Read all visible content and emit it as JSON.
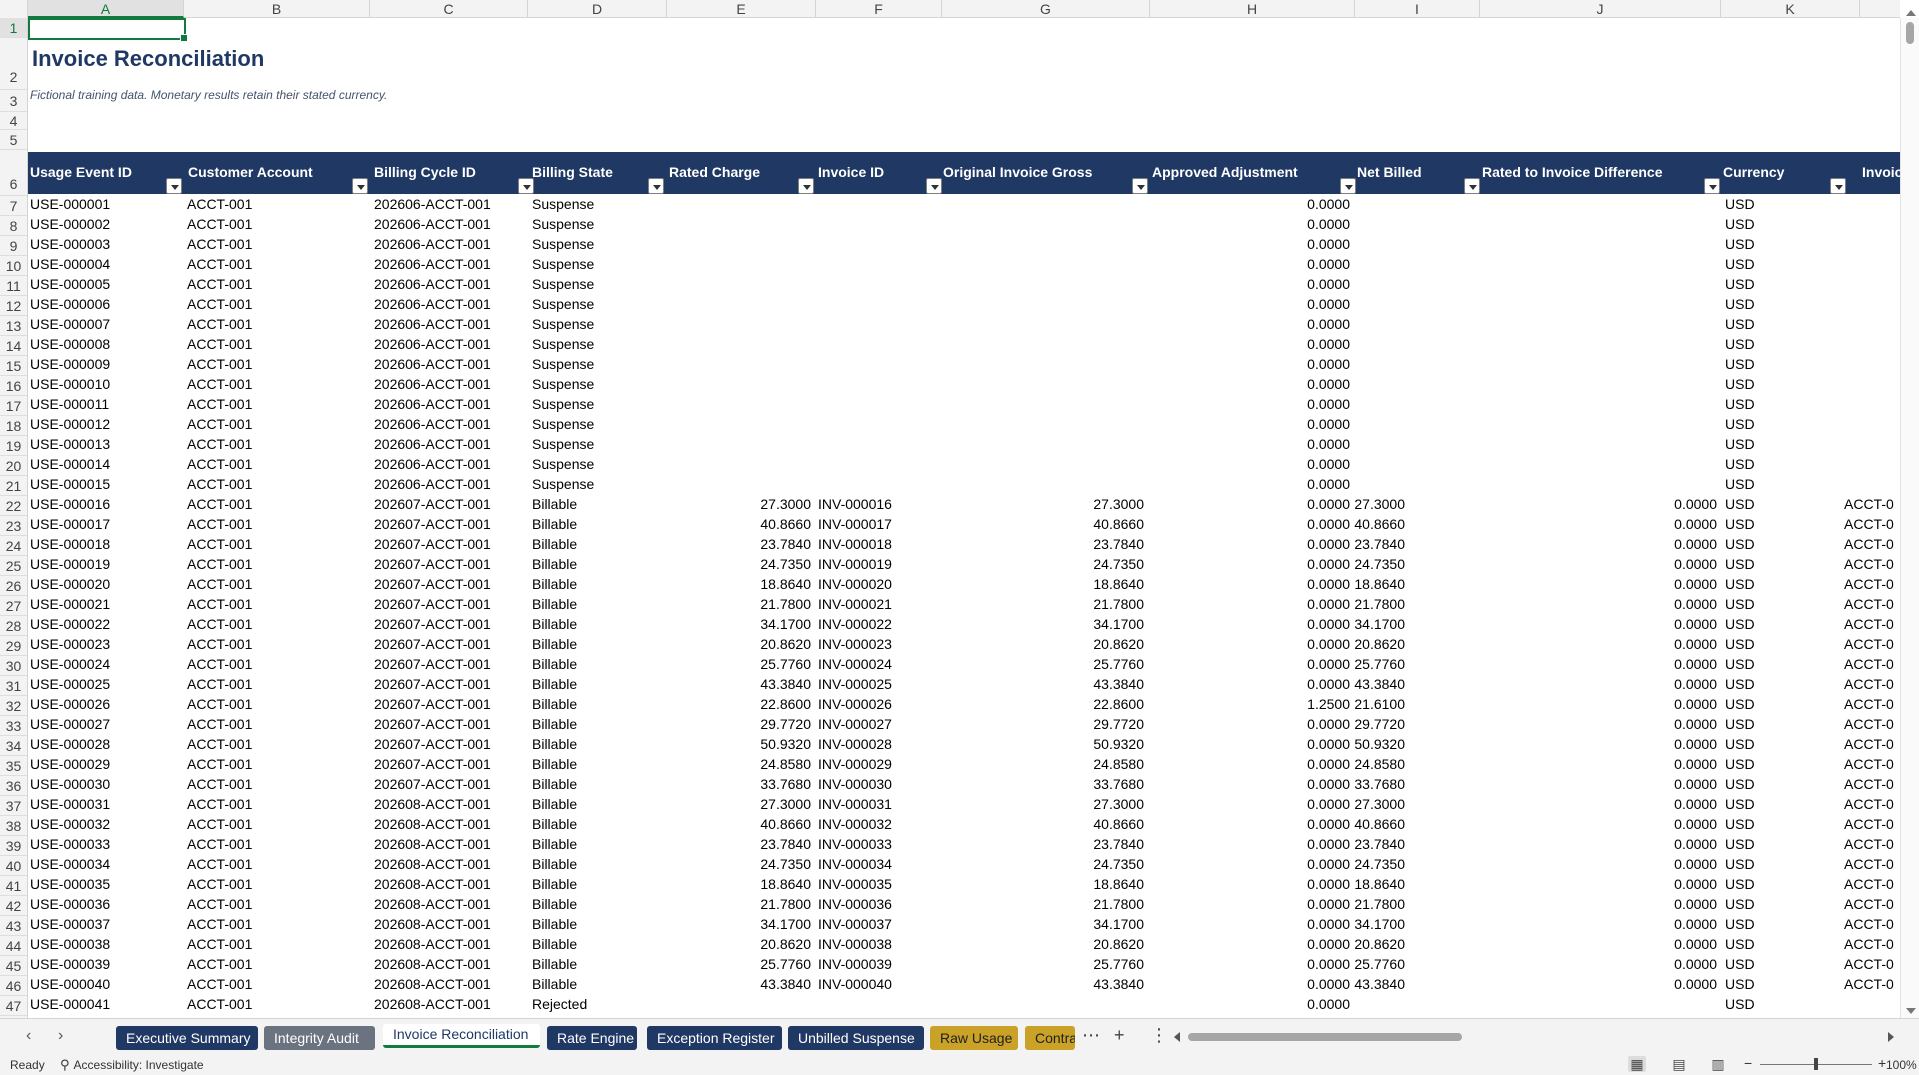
{
  "columns": [
    "A",
    "B",
    "C",
    "D",
    "E",
    "F",
    "G",
    "H",
    "I",
    "J",
    "K"
  ],
  "row_numbers": [
    "1",
    "2",
    "3",
    "4",
    "5",
    "6",
    "7",
    "8",
    "9",
    "10",
    "11",
    "12",
    "13",
    "14",
    "15",
    "16",
    "17",
    "18",
    "19",
    "20",
    "21",
    "22",
    "23",
    "24",
    "25",
    "26",
    "27",
    "28",
    "29",
    "30",
    "31",
    "32",
    "33",
    "34",
    "35",
    "36",
    "37",
    "38",
    "39",
    "40",
    "41",
    "42",
    "43",
    "44",
    "45",
    "46",
    "47"
  ],
  "sheet": {
    "title": "Invoice Reconciliation",
    "subtitle": "Fictional training data. Monetary results retain their stated currency."
  },
  "table": {
    "headers": [
      "Usage Event ID",
      "Customer Account",
      "Billing Cycle ID",
      "Billing State",
      "Rated Charge",
      "Invoice ID",
      "Original Invoice Gross",
      "Approved Adjustment",
      "Net Billed",
      "Rated to Invoice Difference",
      "Currency",
      "Invoice"
    ],
    "rows": [
      [
        "USE-000001",
        "ACCT-001",
        "202606-ACCT-001",
        "Suspense",
        "",
        "",
        "",
        "0.0000",
        "",
        "",
        "USD",
        ""
      ],
      [
        "USE-000002",
        "ACCT-001",
        "202606-ACCT-001",
        "Suspense",
        "",
        "",
        "",
        "0.0000",
        "",
        "",
        "USD",
        ""
      ],
      [
        "USE-000003",
        "ACCT-001",
        "202606-ACCT-001",
        "Suspense",
        "",
        "",
        "",
        "0.0000",
        "",
        "",
        "USD",
        ""
      ],
      [
        "USE-000004",
        "ACCT-001",
        "202606-ACCT-001",
        "Suspense",
        "",
        "",
        "",
        "0.0000",
        "",
        "",
        "USD",
        ""
      ],
      [
        "USE-000005",
        "ACCT-001",
        "202606-ACCT-001",
        "Suspense",
        "",
        "",
        "",
        "0.0000",
        "",
        "",
        "USD",
        ""
      ],
      [
        "USE-000006",
        "ACCT-001",
        "202606-ACCT-001",
        "Suspense",
        "",
        "",
        "",
        "0.0000",
        "",
        "",
        "USD",
        ""
      ],
      [
        "USE-000007",
        "ACCT-001",
        "202606-ACCT-001",
        "Suspense",
        "",
        "",
        "",
        "0.0000",
        "",
        "",
        "USD",
        ""
      ],
      [
        "USE-000008",
        "ACCT-001",
        "202606-ACCT-001",
        "Suspense",
        "",
        "",
        "",
        "0.0000",
        "",
        "",
        "USD",
        ""
      ],
      [
        "USE-000009",
        "ACCT-001",
        "202606-ACCT-001",
        "Suspense",
        "",
        "",
        "",
        "0.0000",
        "",
        "",
        "USD",
        ""
      ],
      [
        "USE-000010",
        "ACCT-001",
        "202606-ACCT-001",
        "Suspense",
        "",
        "",
        "",
        "0.0000",
        "",
        "",
        "USD",
        ""
      ],
      [
        "USE-000011",
        "ACCT-001",
        "202606-ACCT-001",
        "Suspense",
        "",
        "",
        "",
        "0.0000",
        "",
        "",
        "USD",
        ""
      ],
      [
        "USE-000012",
        "ACCT-001",
        "202606-ACCT-001",
        "Suspense",
        "",
        "",
        "",
        "0.0000",
        "",
        "",
        "USD",
        ""
      ],
      [
        "USE-000013",
        "ACCT-001",
        "202606-ACCT-001",
        "Suspense",
        "",
        "",
        "",
        "0.0000",
        "",
        "",
        "USD",
        ""
      ],
      [
        "USE-000014",
        "ACCT-001",
        "202606-ACCT-001",
        "Suspense",
        "",
        "",
        "",
        "0.0000",
        "",
        "",
        "USD",
        ""
      ],
      [
        "USE-000015",
        "ACCT-001",
        "202606-ACCT-001",
        "Suspense",
        "",
        "",
        "",
        "0.0000",
        "",
        "",
        "USD",
        ""
      ],
      [
        "USE-000016",
        "ACCT-001",
        "202607-ACCT-001",
        "Billable",
        "27.3000",
        "INV-000016",
        "27.3000",
        "0.0000",
        "27.3000",
        "0.0000",
        "USD",
        "ACCT-0"
      ],
      [
        "USE-000017",
        "ACCT-001",
        "202607-ACCT-001",
        "Billable",
        "40.8660",
        "INV-000017",
        "40.8660",
        "0.0000",
        "40.8660",
        "0.0000",
        "USD",
        "ACCT-0"
      ],
      [
        "USE-000018",
        "ACCT-001",
        "202607-ACCT-001",
        "Billable",
        "23.7840",
        "INV-000018",
        "23.7840",
        "0.0000",
        "23.7840",
        "0.0000",
        "USD",
        "ACCT-0"
      ],
      [
        "USE-000019",
        "ACCT-001",
        "202607-ACCT-001",
        "Billable",
        "24.7350",
        "INV-000019",
        "24.7350",
        "0.0000",
        "24.7350",
        "0.0000",
        "USD",
        "ACCT-0"
      ],
      [
        "USE-000020",
        "ACCT-001",
        "202607-ACCT-001",
        "Billable",
        "18.8640",
        "INV-000020",
        "18.8640",
        "0.0000",
        "18.8640",
        "0.0000",
        "USD",
        "ACCT-0"
      ],
      [
        "USE-000021",
        "ACCT-001",
        "202607-ACCT-001",
        "Billable",
        "21.7800",
        "INV-000021",
        "21.7800",
        "0.0000",
        "21.7800",
        "0.0000",
        "USD",
        "ACCT-0"
      ],
      [
        "USE-000022",
        "ACCT-001",
        "202607-ACCT-001",
        "Billable",
        "34.1700",
        "INV-000022",
        "34.1700",
        "0.0000",
        "34.1700",
        "0.0000",
        "USD",
        "ACCT-0"
      ],
      [
        "USE-000023",
        "ACCT-001",
        "202607-ACCT-001",
        "Billable",
        "20.8620",
        "INV-000023",
        "20.8620",
        "0.0000",
        "20.8620",
        "0.0000",
        "USD",
        "ACCT-0"
      ],
      [
        "USE-000024",
        "ACCT-001",
        "202607-ACCT-001",
        "Billable",
        "25.7760",
        "INV-000024",
        "25.7760",
        "0.0000",
        "25.7760",
        "0.0000",
        "USD",
        "ACCT-0"
      ],
      [
        "USE-000025",
        "ACCT-001",
        "202607-ACCT-001",
        "Billable",
        "43.3840",
        "INV-000025",
        "43.3840",
        "0.0000",
        "43.3840",
        "0.0000",
        "USD",
        "ACCT-0"
      ],
      [
        "USE-000026",
        "ACCT-001",
        "202607-ACCT-001",
        "Billable",
        "22.8600",
        "INV-000026",
        "22.8600",
        "1.2500",
        "21.6100",
        "0.0000",
        "USD",
        "ACCT-0"
      ],
      [
        "USE-000027",
        "ACCT-001",
        "202607-ACCT-001",
        "Billable",
        "29.7720",
        "INV-000027",
        "29.7720",
        "0.0000",
        "29.7720",
        "0.0000",
        "USD",
        "ACCT-0"
      ],
      [
        "USE-000028",
        "ACCT-001",
        "202607-ACCT-001",
        "Billable",
        "50.9320",
        "INV-000028",
        "50.9320",
        "0.0000",
        "50.9320",
        "0.0000",
        "USD",
        "ACCT-0"
      ],
      [
        "USE-000029",
        "ACCT-001",
        "202607-ACCT-001",
        "Billable",
        "24.8580",
        "INV-000029",
        "24.8580",
        "0.0000",
        "24.8580",
        "0.0000",
        "USD",
        "ACCT-0"
      ],
      [
        "USE-000030",
        "ACCT-001",
        "202607-ACCT-001",
        "Billable",
        "33.7680",
        "INV-000030",
        "33.7680",
        "0.0000",
        "33.7680",
        "0.0000",
        "USD",
        "ACCT-0"
      ],
      [
        "USE-000031",
        "ACCT-001",
        "202608-ACCT-001",
        "Billable",
        "27.3000",
        "INV-000031",
        "27.3000",
        "0.0000",
        "27.3000",
        "0.0000",
        "USD",
        "ACCT-0"
      ],
      [
        "USE-000032",
        "ACCT-001",
        "202608-ACCT-001",
        "Billable",
        "40.8660",
        "INV-000032",
        "40.8660",
        "0.0000",
        "40.8660",
        "0.0000",
        "USD",
        "ACCT-0"
      ],
      [
        "USE-000033",
        "ACCT-001",
        "202608-ACCT-001",
        "Billable",
        "23.7840",
        "INV-000033",
        "23.7840",
        "0.0000",
        "23.7840",
        "0.0000",
        "USD",
        "ACCT-0"
      ],
      [
        "USE-000034",
        "ACCT-001",
        "202608-ACCT-001",
        "Billable",
        "24.7350",
        "INV-000034",
        "24.7350",
        "0.0000",
        "24.7350",
        "0.0000",
        "USD",
        "ACCT-0"
      ],
      [
        "USE-000035",
        "ACCT-001",
        "202608-ACCT-001",
        "Billable",
        "18.8640",
        "INV-000035",
        "18.8640",
        "0.0000",
        "18.8640",
        "0.0000",
        "USD",
        "ACCT-0"
      ],
      [
        "USE-000036",
        "ACCT-001",
        "202608-ACCT-001",
        "Billable",
        "21.7800",
        "INV-000036",
        "21.7800",
        "0.0000",
        "21.7800",
        "0.0000",
        "USD",
        "ACCT-0"
      ],
      [
        "USE-000037",
        "ACCT-001",
        "202608-ACCT-001",
        "Billable",
        "34.1700",
        "INV-000037",
        "34.1700",
        "0.0000",
        "34.1700",
        "0.0000",
        "USD",
        "ACCT-0"
      ],
      [
        "USE-000038",
        "ACCT-001",
        "202608-ACCT-001",
        "Billable",
        "20.8620",
        "INV-000038",
        "20.8620",
        "0.0000",
        "20.8620",
        "0.0000",
        "USD",
        "ACCT-0"
      ],
      [
        "USE-000039",
        "ACCT-001",
        "202608-ACCT-001",
        "Billable",
        "25.7760",
        "INV-000039",
        "25.7760",
        "0.0000",
        "25.7760",
        "0.0000",
        "USD",
        "ACCT-0"
      ],
      [
        "USE-000040",
        "ACCT-001",
        "202608-ACCT-001",
        "Billable",
        "43.3840",
        "INV-000040",
        "43.3840",
        "0.0000",
        "43.3840",
        "0.0000",
        "USD",
        "ACCT-0"
      ],
      [
        "USE-000041",
        "ACCT-001",
        "202608-ACCT-001",
        "Rejected",
        "",
        "",
        "",
        "0.0000",
        "",
        "",
        "USD",
        ""
      ]
    ]
  },
  "tabs": [
    {
      "label": "Executive Summary",
      "color": "#1f3864",
      "active": false
    },
    {
      "label": "Integrity Audit",
      "color": "#6b7280",
      "active": false
    },
    {
      "label": "Invoice Reconciliation",
      "color": "#ffffff",
      "active": true
    },
    {
      "label": "Rate Engine",
      "color": "#1f3864",
      "active": false
    },
    {
      "label": "Exception Register",
      "color": "#1f3864",
      "active": false
    },
    {
      "label": "Unbilled Suspense",
      "color": "#1f3864",
      "active": false
    },
    {
      "label": "Raw Usage",
      "color": "#c9a227",
      "active": false
    },
    {
      "label": "Contra",
      "color": "#c9a227",
      "active": false
    }
  ],
  "tab_controls": {
    "more": "⋯",
    "add": "+",
    "menu": "⋮"
  },
  "status": {
    "ready": "Ready",
    "accessibility": "Accessibility: Investigate",
    "zoom": "100%"
  },
  "colors": {
    "header_fill": "#1f3864",
    "title": "#1f3864",
    "selection": "#137a3f"
  }
}
